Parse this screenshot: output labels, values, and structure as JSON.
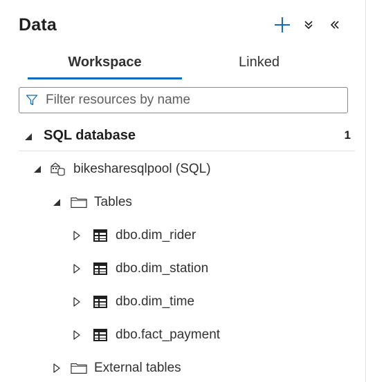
{
  "panel": {
    "title": "Data",
    "actions": {
      "add_icon": "plus-icon",
      "expand_all_icon": "double-chevron-down-icon",
      "collapse_panel_icon": "double-chevron-left-icon"
    }
  },
  "tabs": [
    {
      "label": "Workspace",
      "active": true
    },
    {
      "label": "Linked",
      "active": false
    }
  ],
  "filter": {
    "placeholder": "Filter resources by name",
    "value": "",
    "icon": "filter-icon"
  },
  "section": {
    "label": "SQL database",
    "count": "1",
    "expanded": true
  },
  "tree": {
    "pool": {
      "label": "bikesharesqlpool (SQL)",
      "icon": "sql-pool-icon",
      "expanded": true
    },
    "tables_folder": {
      "label": "Tables",
      "icon": "folder-icon",
      "expanded": true
    },
    "tables": [
      {
        "label": "dbo.dim_rider",
        "icon": "table-icon"
      },
      {
        "label": "dbo.dim_station",
        "icon": "table-icon"
      },
      {
        "label": "dbo.dim_time",
        "icon": "table-icon"
      },
      {
        "label": "dbo.fact_payment",
        "icon": "table-icon"
      }
    ],
    "external_folder": {
      "label": "External tables",
      "icon": "folder-icon",
      "expanded": false
    }
  },
  "colors": {
    "accent": "#0f6cbd",
    "text": "#1f1f1f",
    "border": "#8a8886",
    "divider": "#e1e1e1"
  }
}
